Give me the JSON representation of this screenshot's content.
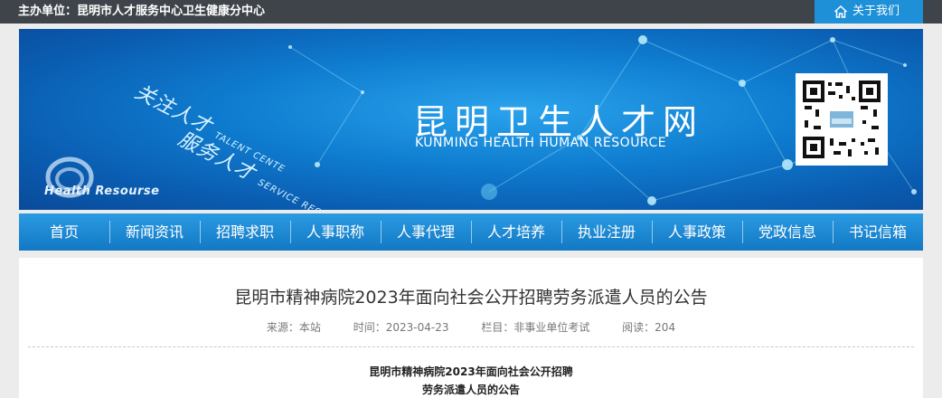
{
  "topbar": {
    "host_text": "主办单位：昆明市人才服务中心卫生健康分中心",
    "about_label": "关于我们",
    "about_icon": "home-icon"
  },
  "banner": {
    "slogan_line1_cn": "关注人才",
    "slogan_line1_en": "TALENT CENTE",
    "slogan_line2_cn": "服务人才",
    "slogan_line2_en": "SERVICE RESOURCES",
    "logo_text": "Health Resourse",
    "site_name": "昆明卫生人才网",
    "site_name_en": "KUNMING HEALTH HUMAN RESOURCE",
    "qr_icon": "qr-code-icon"
  },
  "nav": {
    "items": [
      {
        "label": "首页"
      },
      {
        "label": "新闻资讯"
      },
      {
        "label": "招聘求职"
      },
      {
        "label": "人事职称"
      },
      {
        "label": "人事代理"
      },
      {
        "label": "人才培养"
      },
      {
        "label": "执业注册"
      },
      {
        "label": "人事政策"
      },
      {
        "label": "党政信息"
      },
      {
        "label": "书记信箱"
      }
    ]
  },
  "article": {
    "title": "昆明市精神病院2023年面向社会公开招聘劳务派遣人员的公告",
    "source": "来源：本站",
    "time": "时间：2023-04-23",
    "column": "栏目：非事业单位考试",
    "views": "阅读：204",
    "subtitle_line1": "昆明市精神病院2023年面向社会公开招聘",
    "subtitle_line2": "劳务派遣人员的公告"
  },
  "colors": {
    "topbar_bg": "#3f444a",
    "accent": "#1e90d8",
    "nav_bg": "#1a86d2",
    "banner_bg": "#0f7dd0"
  }
}
